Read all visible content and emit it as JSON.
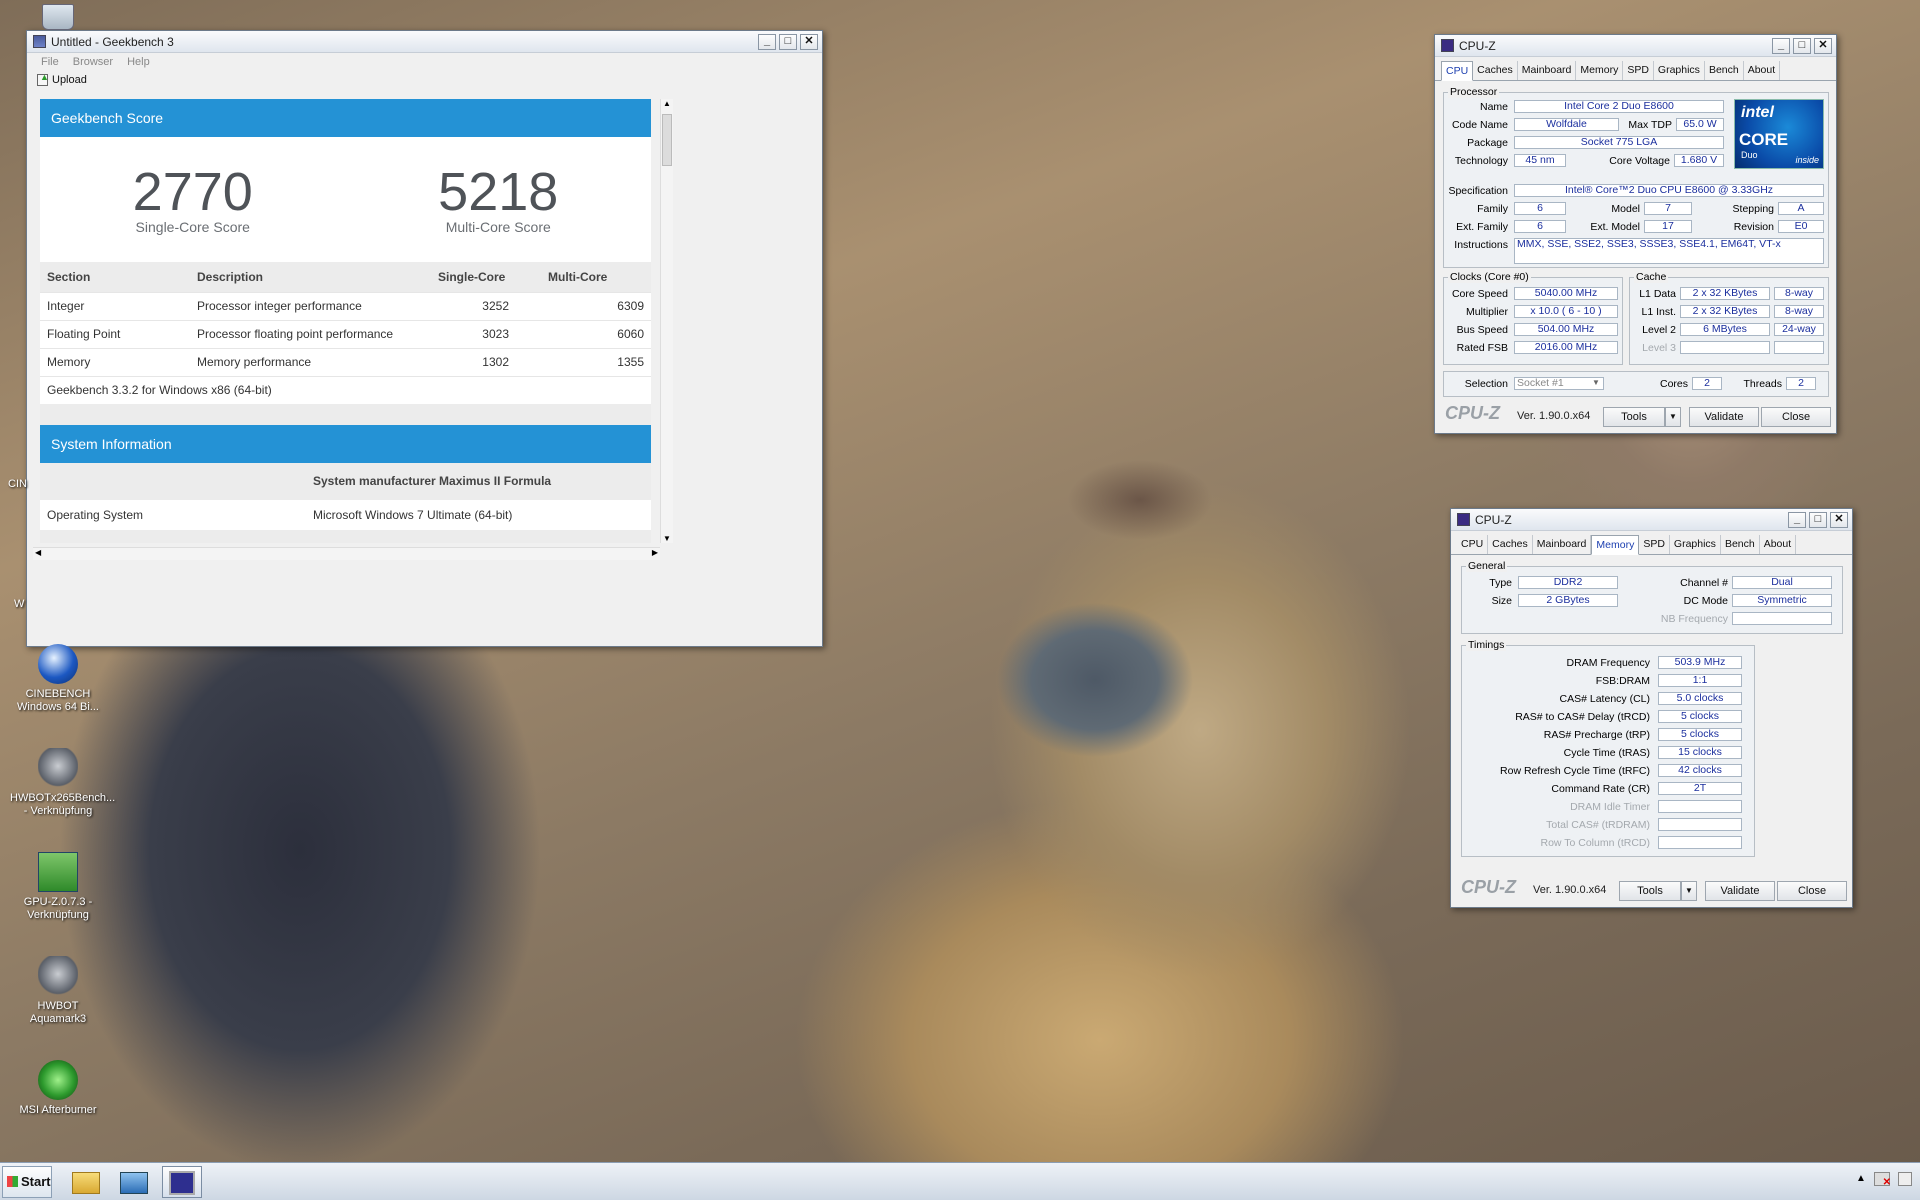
{
  "geekbench": {
    "title": "Untitled - Geekbench 3",
    "menu": [
      "File",
      "Browser",
      "Help"
    ],
    "upload": "Upload",
    "score_header": "Geekbench Score",
    "single_score": "2770",
    "single_label": "Single-Core Score",
    "multi_score": "5218",
    "multi_label": "Multi-Core Score",
    "columns": [
      "Section",
      "Description",
      "Single-Core",
      "Multi-Core"
    ],
    "rows": [
      {
        "section": "Integer",
        "desc": "Processor integer performance",
        "single": "3252",
        "multi": "6309"
      },
      {
        "section": "Floating Point",
        "desc": "Processor floating point performance",
        "single": "3023",
        "multi": "6060"
      },
      {
        "section": "Memory",
        "desc": "Memory performance",
        "single": "1302",
        "multi": "1355"
      }
    ],
    "version": "Geekbench 3.3.2 for Windows x86 (64-bit)",
    "sys_header": "System Information",
    "sys_model": "System manufacturer Maximus II Formula",
    "os_label": "Operating System",
    "os_value": "Microsoft Windows 7 Ultimate (64-bit)"
  },
  "cpuz1": {
    "title": "CPU-Z",
    "tabs": [
      "CPU",
      "Caches",
      "Mainboard",
      "Memory",
      "SPD",
      "Graphics",
      "Bench",
      "About"
    ],
    "processor_group": "Processor",
    "name_l": "Name",
    "name": "Intel Core 2 Duo E8600",
    "code_l": "Code Name",
    "code": "Wolfdale",
    "tdp_l": "Max TDP",
    "tdp": "65.0 W",
    "pkg_l": "Package",
    "pkg": "Socket 775 LGA",
    "tech_l": "Technology",
    "tech": "45 nm",
    "cv_l": "Core Voltage",
    "cv": "1.680 V",
    "spec_l": "Specification",
    "spec": "Intel® Core™2 Duo CPU     E8600  @ 3.33GHz",
    "fam_l": "Family",
    "fam": "6",
    "model_l": "Model",
    "model": "7",
    "step_l": "Stepping",
    "step": "A",
    "efam_l": "Ext. Family",
    "efam": "6",
    "emod_l": "Ext. Model",
    "emod": "17",
    "rev_l": "Revision",
    "rev": "E0",
    "inst_l": "Instructions",
    "inst": "MMX, SSE, SSE2, SSE3, SSSE3, SSE4.1, EM64T, VT-x",
    "clocks_group": "Clocks (Core #0)",
    "cs_l": "Core Speed",
    "cs": "5040.00 MHz",
    "mul_l": "Multiplier",
    "mul": "x 10.0 ( 6 - 10 )",
    "bs_l": "Bus Speed",
    "bs": "504.00 MHz",
    "fsb_l": "Rated FSB",
    "fsb": "2016.00 MHz",
    "cache_group": "Cache",
    "l1d_l": "L1 Data",
    "l1d": "2 x 32 KBytes",
    "l1d_w": "8-way",
    "l1i_l": "L1 Inst.",
    "l1i": "2 x 32 KBytes",
    "l1i_w": "8-way",
    "l2_l": "Level 2",
    "l2": "6 MBytes",
    "l2_w": "24-way",
    "l3_l": "Level 3",
    "sel_l": "Selection",
    "sel": "Socket #1",
    "cores_l": "Cores",
    "cores": "2",
    "threads_l": "Threads",
    "threads": "2",
    "logo": "CPU-Z",
    "ver": "Ver. 1.90.0.x64",
    "tools": "Tools",
    "validate": "Validate",
    "close": "Close",
    "intel_badge": "intel",
    "intel_core": "CORE",
    "intel_duo": "Duo",
    "intel_inside": "inside"
  },
  "cpuz2": {
    "title": "CPU-Z",
    "tabs": [
      "CPU",
      "Caches",
      "Mainboard",
      "Memory",
      "SPD",
      "Graphics",
      "Bench",
      "About"
    ],
    "general_group": "General",
    "type_l": "Type",
    "type": "DDR2",
    "ch_l": "Channel #",
    "ch": "Dual",
    "size_l": "Size",
    "size": "2 GBytes",
    "dc_l": "DC Mode",
    "dc": "Symmetric",
    "nb_l": "NB Frequency",
    "timings_group": "Timings",
    "timings": [
      {
        "l": "DRAM Frequency",
        "v": "503.9 MHz"
      },
      {
        "l": "FSB:DRAM",
        "v": "1:1"
      },
      {
        "l": "CAS# Latency (CL)",
        "v": "5.0 clocks"
      },
      {
        "l": "RAS# to CAS# Delay (tRCD)",
        "v": "5 clocks"
      },
      {
        "l": "RAS# Precharge (tRP)",
        "v": "5 clocks"
      },
      {
        "l": "Cycle Time (tRAS)",
        "v": "15 clocks"
      },
      {
        "l": "Row Refresh Cycle Time (tRFC)",
        "v": "42 clocks"
      },
      {
        "l": "Command Rate (CR)",
        "v": "2T"
      },
      {
        "l": "DRAM Idle Timer",
        "v": ""
      },
      {
        "l": "Total CAS# (tRDRAM)",
        "v": ""
      },
      {
        "l": "Row To Column (tRCD)",
        "v": ""
      }
    ],
    "logo": "CPU-Z",
    "ver": "Ver. 1.90.0.x64",
    "tools": "Tools",
    "validate": "Validate",
    "close": "Close"
  },
  "desktop_icons": [
    {
      "label": "CINEBENCH Windows 64 Bi..."
    },
    {
      "label": "HWBOTx265Bench... - Verknüpfung"
    },
    {
      "label": "GPU-Z.0.7.3 - Verknüpfung"
    },
    {
      "label": "HWBOT Aquamark3"
    },
    {
      "label": "MSI Afterburner"
    }
  ],
  "edge_labels": {
    "cin": "CIN",
    "w": "W"
  },
  "taskbar": {
    "start": "Start"
  }
}
